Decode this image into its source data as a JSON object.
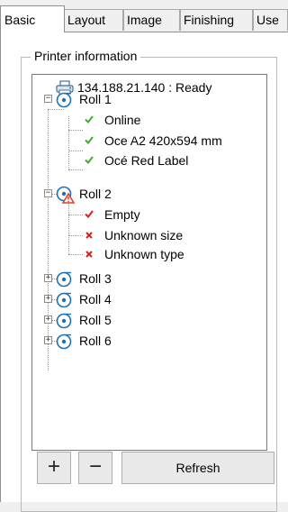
{
  "tabs": [
    {
      "label": "Basic"
    },
    {
      "label": "Layout"
    },
    {
      "label": "Image"
    },
    {
      "label": "Finishing"
    },
    {
      "label": "Use"
    }
  ],
  "group_title": "Printer information",
  "tree": {
    "printer": {
      "label": "134.188.21.140 : Ready",
      "icon": "printer-icon"
    },
    "roll1": {
      "label": "Roll 1",
      "icon": "roll-icon",
      "expander": "−",
      "children": [
        {
          "label": "Online",
          "status": "check",
          "color": "#44aa33"
        },
        {
          "label": "Oce A2 420x594 mm",
          "status": "check",
          "color": "#44aa33"
        },
        {
          "label": "Océ Red Label",
          "status": "check",
          "color": "#44aa33"
        }
      ]
    },
    "roll2": {
      "label": "Roll 2",
      "icon": "roll-warning-icon",
      "expander": "−",
      "children": [
        {
          "label": "Empty",
          "status": "check",
          "color": "#d62020"
        },
        {
          "label": "Unknown size",
          "status": "cross",
          "color": "#d62020"
        },
        {
          "label": "Unknown type",
          "status": "cross",
          "color": "#d62020"
        }
      ]
    },
    "collapsed_rolls": [
      {
        "label": "Roll 3",
        "expander": "+"
      },
      {
        "label": "Roll 4",
        "expander": "+"
      },
      {
        "label": "Roll 5",
        "expander": "+"
      },
      {
        "label": "Roll 6",
        "expander": "+"
      }
    ]
  },
  "buttons": {
    "add": "+",
    "remove": "−",
    "refresh": "Refresh"
  },
  "colors": {
    "roll_icon": "#1a73b8",
    "warning": "#e23b2a"
  }
}
